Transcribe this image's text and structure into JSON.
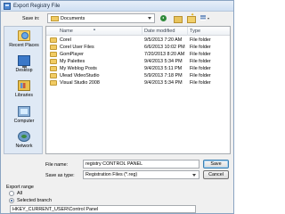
{
  "window": {
    "title": "Export Registry File"
  },
  "toolbar": {
    "save_in_label": "Save in:",
    "save_in_value": "Documents"
  },
  "places": [
    {
      "label": "Recent Places",
      "icon": "recent-places-icon"
    },
    {
      "label": "Desktop",
      "icon": "desktop-icon"
    },
    {
      "label": "Libraries",
      "icon": "libraries-icon"
    },
    {
      "label": "Computer",
      "icon": "computer-icon"
    },
    {
      "label": "Network",
      "icon": "network-icon"
    }
  ],
  "file_list": {
    "columns": {
      "name": "Name",
      "date": "Date modified",
      "type": "Type"
    },
    "rows": [
      {
        "name": "Corel",
        "date": "9/5/2013 7:20 AM",
        "type": "File folder"
      },
      {
        "name": "Corel User Files",
        "date": "6/6/2013 10:02 PM",
        "type": "File folder"
      },
      {
        "name": "GomPlayer",
        "date": "7/20/2013 8:20 AM",
        "type": "File folder"
      },
      {
        "name": "My Palettes",
        "date": "9/4/2013 5:34 PM",
        "type": "File folder"
      },
      {
        "name": "My Weblog Posts",
        "date": "9/4/2013 5:11 PM",
        "type": "File folder"
      },
      {
        "name": "Ulead VideoStudio",
        "date": "5/9/2013 7:18 PM",
        "type": "File folder"
      },
      {
        "name": "Visual Studio 2008",
        "date": "9/4/2013 5:34 PM",
        "type": "File folder"
      }
    ]
  },
  "form": {
    "file_name_label": "File name:",
    "file_name_value": "registry CONTROL PANEL",
    "save_as_label": "Save as type:",
    "save_as_value": "Registration Files (*.reg)",
    "save_button": "Save",
    "cancel_button": "Cancel"
  },
  "export_range": {
    "label": "Export range",
    "option_all": "All",
    "option_selected": "Selected branch",
    "selected": "Selected branch",
    "branch_value": "HKEY_CURRENT_USER\\Control Panel"
  }
}
